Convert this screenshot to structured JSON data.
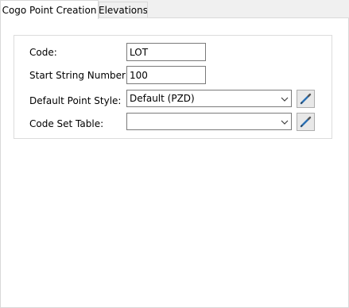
{
  "tabs": [
    {
      "label": "Cogo Point Creation",
      "active": true
    },
    {
      "label": "Elevations",
      "active": false
    }
  ],
  "form": {
    "code": {
      "label": "Code:",
      "value": "LOT"
    },
    "start_string_number": {
      "label": "Start String Number:",
      "value": "100"
    },
    "default_point_style": {
      "label": "Default Point Style:",
      "selected": "Default (PZD)"
    },
    "code_set_table": {
      "label": "Code Set Table:",
      "selected": ""
    }
  },
  "icons": {
    "dropdown": "chevron-down-icon",
    "edit": "pencil-icon"
  },
  "colors": {
    "panel_background": "#ffffff",
    "window_background": "#f0f0f0",
    "border": "#7a7a7a",
    "pencil_accent": "#2a6fb3"
  }
}
